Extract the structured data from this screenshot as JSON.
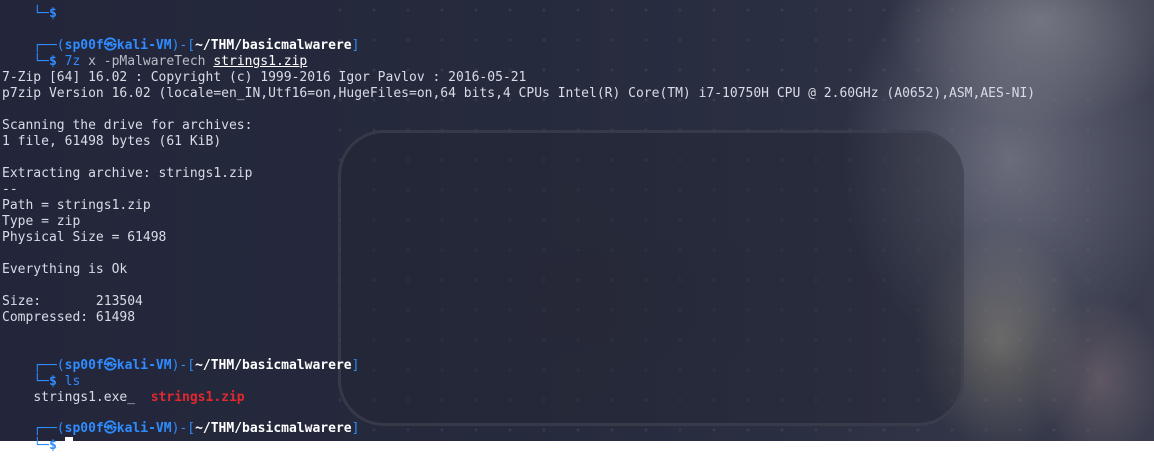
{
  "prompt": {
    "user": "sp00f",
    "host": "kali-VM",
    "at_symbol": "㉿",
    "box_top": "┌──(",
    "box_mid": ")-[",
    "box_end": "]",
    "box_bottom": "└─",
    "dollar": "$"
  },
  "blocks": [
    {
      "cwd": "~/THM/basicmalwarere",
      "command": {
        "program": "7z",
        "args": "x -pMalwareTech",
        "file": "strings1.zip"
      }
    },
    {
      "cwd": "~/THM/basicmalwarere",
      "command": {
        "program": "ls",
        "args": "",
        "file": ""
      }
    },
    {
      "cwd": "~/THM/basicmalwarere"
    }
  ],
  "output_7z": [
    "7-Zip [64] 16.02 : Copyright (c) 1999-2016 Igor Pavlov : 2016-05-21",
    "p7zip Version 16.02 (locale=en_IN,Utf16=on,HugeFiles=on,64 bits,4 CPUs Intel(R) Core(TM) i7-10750H CPU @ 2.60GHz (A0652),ASM,AES-NI)",
    "Scanning the drive for archives:",
    "1 file, 61498 bytes (61 KiB)",
    "Extracting archive: strings1.zip",
    "--",
    "Path = strings1.zip",
    "Type = zip",
    "Physical Size = 61498",
    "Everything is Ok",
    "Size:       213504",
    "Compressed: 61498"
  ],
  "output_ls": {
    "file1": "strings1.exe_",
    "file2": "strings1.zip"
  },
  "colors": {
    "prompt_blue": "#2f8cff",
    "command_purple": "#b06ad8",
    "archive_red": "#e0282e"
  }
}
